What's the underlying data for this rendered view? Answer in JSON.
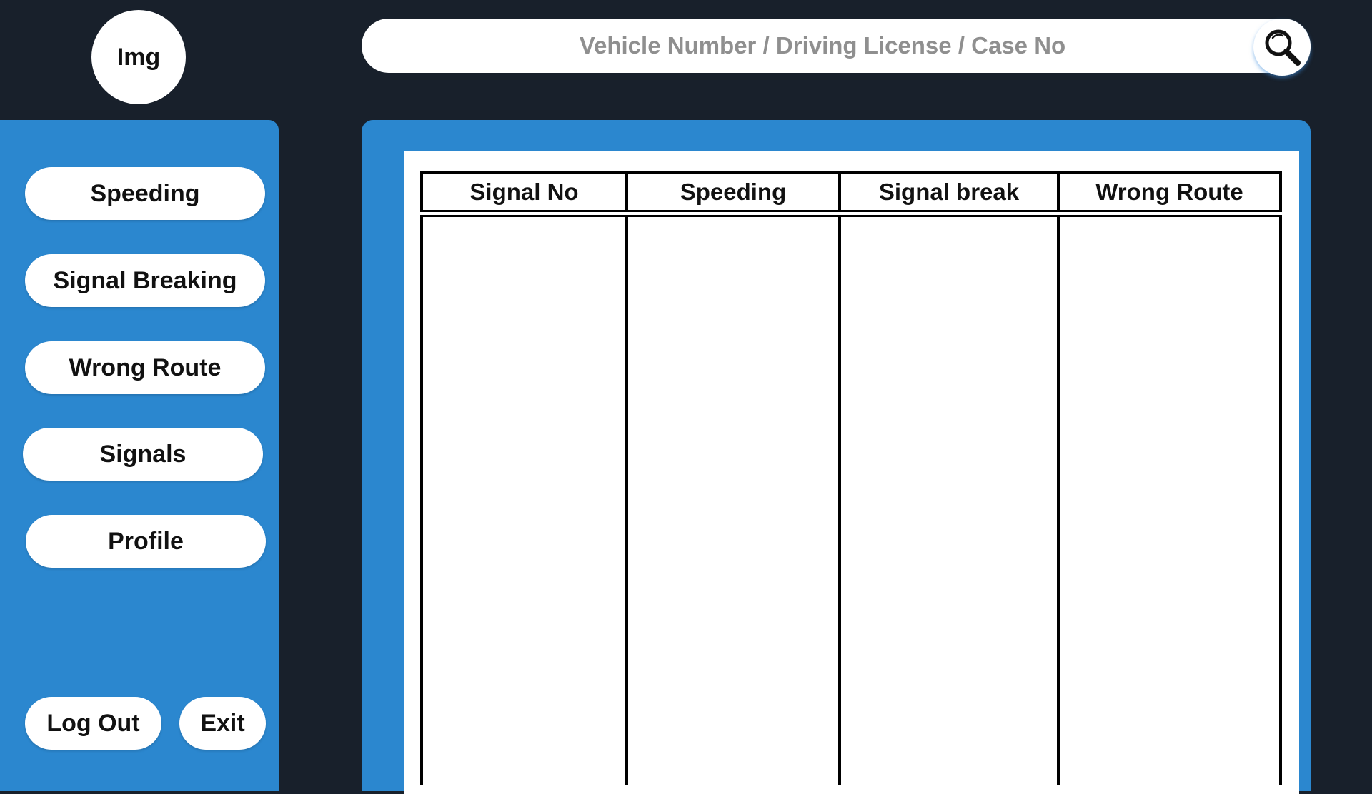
{
  "profile": {
    "avatar_label": "Img"
  },
  "search": {
    "placeholder": "Vehicle Number / Driving License / Case No",
    "icon": "search-icon"
  },
  "sidebar": {
    "items": [
      {
        "label": "Speeding"
      },
      {
        "label": "Signal Breaking"
      },
      {
        "label": "Wrong Route"
      },
      {
        "label": "Signals"
      },
      {
        "label": "Profile"
      }
    ],
    "logout_label": "Log Out",
    "exit_label": "Exit"
  },
  "table": {
    "columns": [
      "Signal No",
      "Speeding",
      "Signal break",
      "Wrong Route"
    ],
    "rows": []
  },
  "colors": {
    "background": "#18202b",
    "accent": "#2b87cf",
    "surface": "#ffffff"
  }
}
